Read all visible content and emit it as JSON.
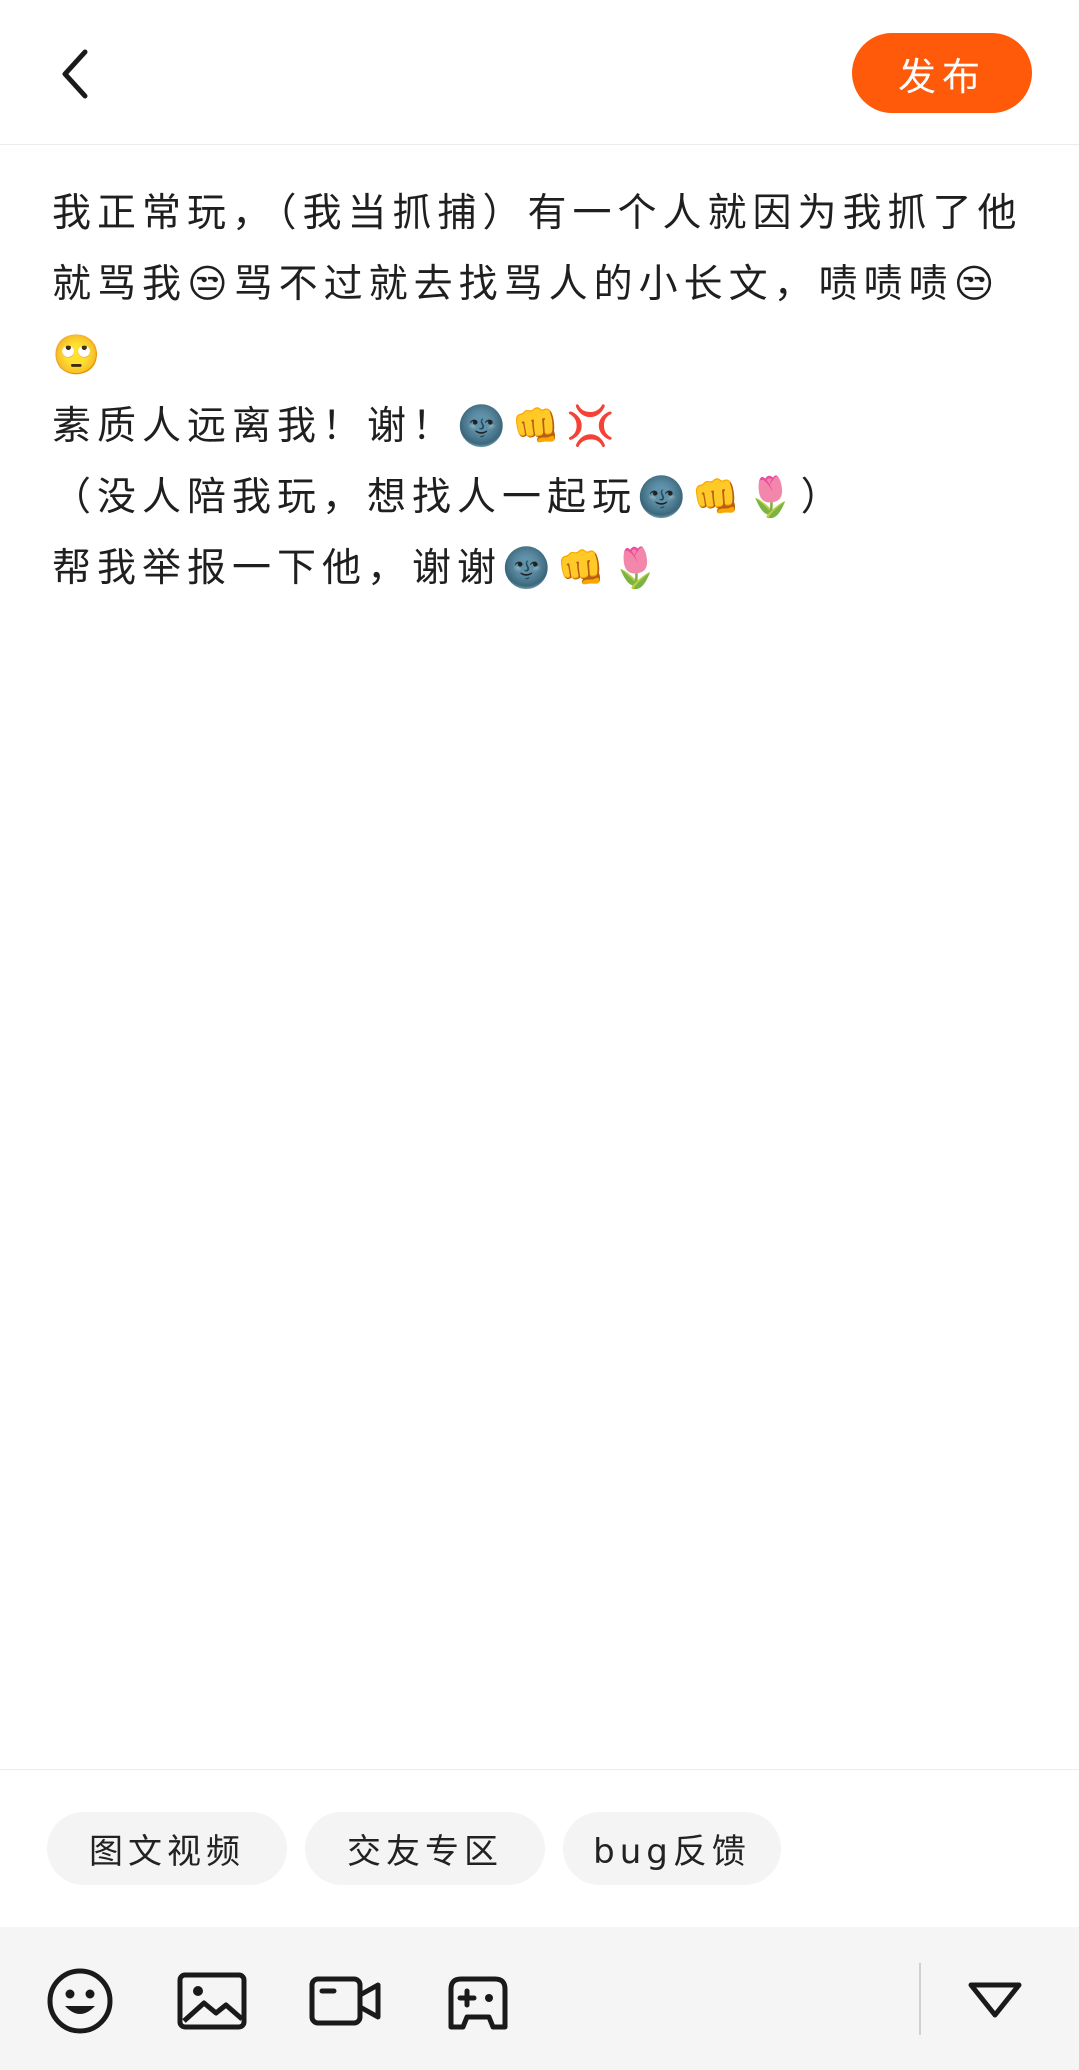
{
  "header": {
    "back_icon": "chevron-left-icon",
    "publish_label": "发布",
    "accent_color": "#ff5a0a"
  },
  "post": {
    "text": "我正常玩，（我当抓捕）有一个人就因为我抓了他就骂我😒骂不过就去找骂人的小长文，啧啧啧😒🙄\n素质人远离我！谢！🌚👊💢\n（没人陪我玩，想找人一起玩🌚👊🌷）\n帮我举报一下他，谢谢🌚👊🌷"
  },
  "tags": [
    {
      "label": "图文视频"
    },
    {
      "label": "交友专区"
    },
    {
      "label": "bug反馈"
    }
  ],
  "toolbar": {
    "icons": [
      "emoji-icon",
      "image-icon",
      "video-icon",
      "game-controller-icon",
      "collapse-triangle-icon"
    ]
  }
}
